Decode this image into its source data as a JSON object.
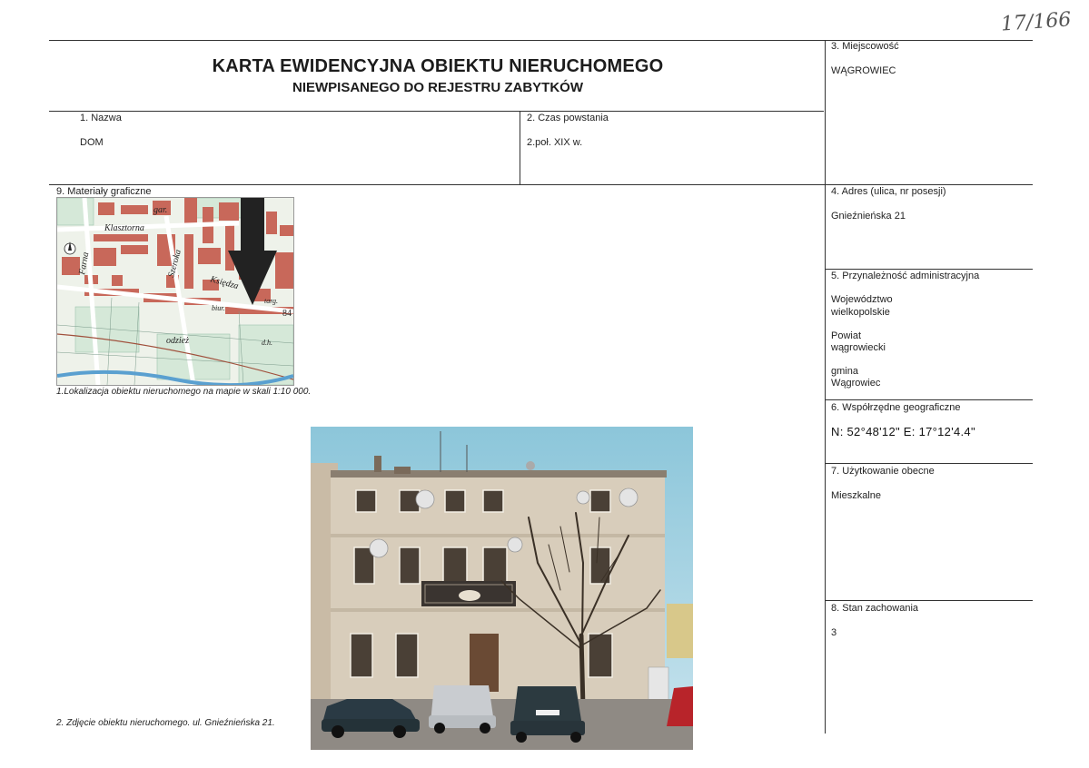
{
  "header": {
    "title": "KARTA EWIDENCYJNA OBIEKTU NIERUCHOMEGO",
    "subtitle": "NIEWPISANEGO DO REJESTRU ZABYTKÓW",
    "inventory_number": "17/166"
  },
  "fields": {
    "nazwa": {
      "label": "1.     Nazwa",
      "value": "DOM"
    },
    "czas_powstania": {
      "label": "2. Czas powstania",
      "value": "2.poł. XIX w."
    },
    "miejscowosc": {
      "label": "3. Miejscowość",
      "value": "WĄGROWIEC"
    },
    "adres": {
      "label": "4. Adres (ulica, nr posesji)",
      "value": "Gnieźnieńska 21"
    },
    "przynaleznosc": {
      "label": "5. Przynależność administracyjna",
      "wojewodztwo_label": "Województwo",
      "wojewodztwo_value": "wielkopolskie",
      "powiat_label": "Powiat",
      "powiat_value": "wągrowiecki",
      "gmina_label": "gmina",
      "gmina_value": "Wągrowiec"
    },
    "wspolrzedne": {
      "label": "6. Współrzędne geograficzne",
      "value": "N: 52°48'12\"  E: 17°12'4.4\""
    },
    "uzytkowanie": {
      "label": "7. Użytkowanie obecne",
      "value": "Mieszkalne"
    },
    "stan": {
      "label": "8. Stan zachowania",
      "value": "3"
    },
    "materialy": {
      "label": "9. Materiały graficzne"
    }
  },
  "map": {
    "caption": "1.Lokalizacja obiektu nieruchomego na mapie w skali 1:10 000.",
    "labels": {
      "klasztorna": "Klasztorna",
      "gar": "gar.",
      "farna": "Farna",
      "szeroka": "Szeroka",
      "ksiedza": "Księdza",
      "targ": "targ.",
      "biur": "biur.",
      "number": "84",
      "odziez": "odzież",
      "dh": "d.h."
    }
  },
  "photo": {
    "caption": "2. Zdjęcie obiektu nieruchomego. ul. Gnieźnieńska 21."
  },
  "colors": {
    "line": "#333333",
    "map_building": "#c8685a",
    "map_grid": "#8fb9a8",
    "sky": "#8fc4d8",
    "facade": "#d9cfbf"
  }
}
